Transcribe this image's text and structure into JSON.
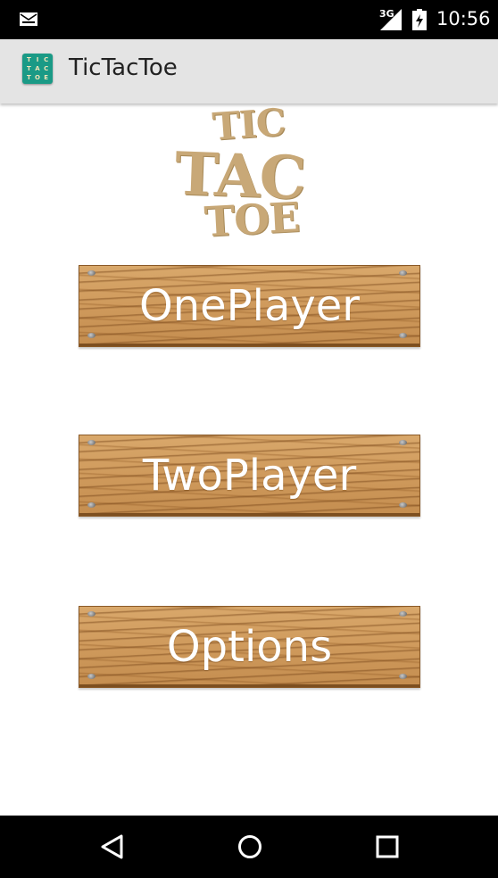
{
  "status_bar": {
    "network_type": "3G",
    "time": "10:56",
    "icons": [
      "mail-icon",
      "signal-icon",
      "battery-icon"
    ]
  },
  "action_bar": {
    "title": "TicTacToe",
    "app_icon_letters": [
      "T",
      "I",
      "C",
      "T",
      "A",
      "C",
      "T",
      "O",
      "E"
    ]
  },
  "logo": {
    "line1": "TIC",
    "line2": "TAC",
    "line3": "TOE",
    "color": "#c8a877"
  },
  "menu": {
    "one_player_label": "OnePlayer",
    "two_player_label": "TwoPlayer",
    "options_label": "Options"
  },
  "nav_bar": {
    "icons": [
      "back-icon",
      "home-icon",
      "recents-icon"
    ]
  },
  "colors": {
    "action_bar_bg": "#e4e4e4",
    "app_icon_bg": "#1a9a86",
    "wood": "#cf9a5c",
    "button_text": "#ffffff"
  }
}
